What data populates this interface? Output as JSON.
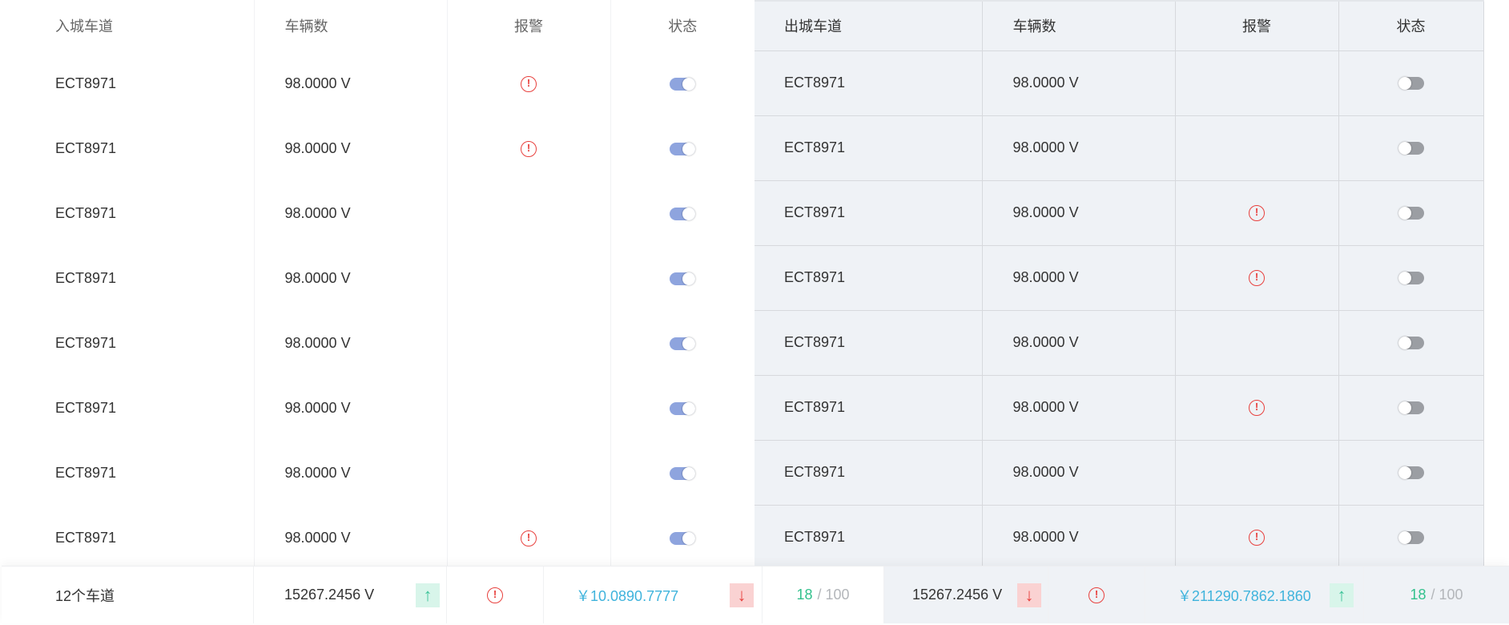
{
  "inbound": {
    "headers": {
      "lane": "入城车道",
      "count": "车辆数",
      "alarm": "报警",
      "status": "状态"
    },
    "rows": [
      {
        "lane": "ECT8971",
        "count": "98.0000 V",
        "alarm": true,
        "status": "on"
      },
      {
        "lane": "ECT8971",
        "count": "98.0000 V",
        "alarm": true,
        "status": "on"
      },
      {
        "lane": "ECT8971",
        "count": "98.0000 V",
        "alarm": false,
        "status": "on"
      },
      {
        "lane": "ECT8971",
        "count": "98.0000 V",
        "alarm": false,
        "status": "on"
      },
      {
        "lane": "ECT8971",
        "count": "98.0000 V",
        "alarm": false,
        "status": "on"
      },
      {
        "lane": "ECT8971",
        "count": "98.0000 V",
        "alarm": false,
        "status": "on"
      },
      {
        "lane": "ECT8971",
        "count": "98.0000 V",
        "alarm": false,
        "status": "on"
      },
      {
        "lane": "ECT8971",
        "count": "98.0000 V",
        "alarm": true,
        "status": "on"
      }
    ]
  },
  "outbound": {
    "headers": {
      "lane": "出城车道",
      "count": "车辆数",
      "alarm": "报警",
      "status": "状态"
    },
    "rows": [
      {
        "lane": "ECT8971",
        "count": "98.0000 V",
        "alarm": false,
        "status": "off"
      },
      {
        "lane": "ECT8971",
        "count": "98.0000 V",
        "alarm": false,
        "status": "off"
      },
      {
        "lane": "ECT8971",
        "count": "98.0000 V",
        "alarm": true,
        "status": "off"
      },
      {
        "lane": "ECT8971",
        "count": "98.0000 V",
        "alarm": true,
        "status": "off"
      },
      {
        "lane": "ECT8971",
        "count": "98.0000 V",
        "alarm": false,
        "status": "off"
      },
      {
        "lane": "ECT8971",
        "count": "98.0000 V",
        "alarm": true,
        "status": "off"
      },
      {
        "lane": "ECT8971",
        "count": "98.0000 V",
        "alarm": false,
        "status": "off"
      },
      {
        "lane": "ECT8971",
        "count": "98.0000 V",
        "alarm": true,
        "status": "off"
      }
    ]
  },
  "footer": {
    "lane_total": "12个车道",
    "inbound_count": "15267.2456 V",
    "inbound_trend": "up",
    "inbound_money": "￥10.0890.7777",
    "inbound_money_trend": "down",
    "inbound_progress": "18",
    "inbound_progress_max": "/ 100",
    "outbound_count": "15267.2456 V",
    "outbound_trend": "down",
    "outbound_money": "￥211290.7862.1860",
    "outbound_money_trend": "up",
    "outbound_progress": "18",
    "outbound_progress_max": "/ 100"
  },
  "icons": {
    "alarm": "alert-circle-icon",
    "arrow_up": "arrow-up-icon",
    "arrow_down": "arrow-down-icon"
  },
  "colors": {
    "alarm": "#e8413e",
    "toggle_on": "#8ea4de",
    "toggle_off": "#9b9ea3",
    "up_bg": "#d8f5ea",
    "up_fg": "#3fc49a",
    "down_bg": "#fad2d2",
    "down_fg": "#e8413e",
    "money": "#3fb3dc",
    "progress": "#33c18d"
  }
}
